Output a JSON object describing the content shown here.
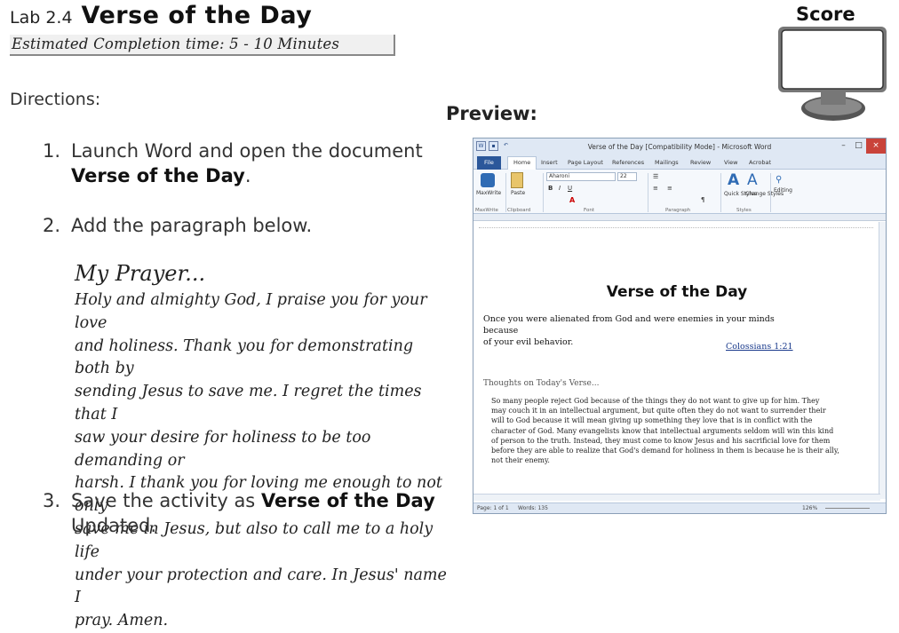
{
  "header": {
    "lab_number": "Lab 2.4",
    "lab_title": "Verse of the Day",
    "completion_time": "Estimated Completion time: 5 - 10 Minutes",
    "score_label": "Score"
  },
  "directions_label": "Directions:",
  "steps": [
    {
      "num": "1.",
      "text_a": "Launch Word and open the  document",
      "bold_a": "Verse of the Day",
      "text_b": "."
    },
    {
      "num": "2.",
      "text_a": "Add the paragraph below."
    },
    {
      "num": "3.",
      "text_a": "Save the activity as ",
      "bold_a": "Verse of the Day",
      "text_b": "Updated."
    }
  ],
  "prayer": {
    "title": "My Prayer...",
    "lines": [
      "Holy and almighty God, I praise you for your love",
      "and holiness. Thank you for demonstrating both by",
      "sending Jesus to save me. I regret the times that I",
      "saw your desire for holiness to be too demanding or",
      "harsh. I thank you for loving me enough to not only",
      "save me in Jesus, but also to call me to a holy life",
      "under your protection and care. In Jesus' name I",
      "pray. Amen."
    ]
  },
  "preview_label": "Preview:",
  "word_window": {
    "title": "Verse of the Day [Compatibility Mode] - Microsoft Word",
    "tabs": [
      "File",
      "Home",
      "Insert",
      "Page Layout",
      "References",
      "Mailings",
      "Review",
      "View",
      "Acrobat"
    ],
    "font_name": "Aharoni",
    "font_size": "22",
    "groups": [
      "MaxWrite",
      "Clipboard",
      "Font",
      "Paragraph",
      "Styles"
    ],
    "ribbon_buttons": [
      "MaxWrite",
      "Paste",
      "Quick Styles",
      "Change Styles",
      "Editing"
    ],
    "status_page": "Page: 1 of 1",
    "status_words": "Words: 135",
    "zoom": "126%"
  },
  "document": {
    "title": "Verse of the Day",
    "verse_lines": [
      "Once you were alienated from God and were enemies in your minds because",
      "of your evil behavior."
    ],
    "reference": "Colossians 1:21",
    "thoughts_heading": "Thoughts on Today's Verse...",
    "body_lines": [
      "So many people reject God because of the things they do not want to give up for him. They",
      "may couch it in an intellectual argument, but quite often they do not want to surrender their",
      "will to God because it will mean giving up something they love that is in conflict with the",
      "character of God. Many evangelists know that intellectual arguments seldom will win this kind",
      "of person to the truth. Instead, they must come to know Jesus and his sacrificial love for them",
      "before they are able to realize that God's demand for holiness in them is because he is their ally,",
      "not their enemy."
    ]
  }
}
